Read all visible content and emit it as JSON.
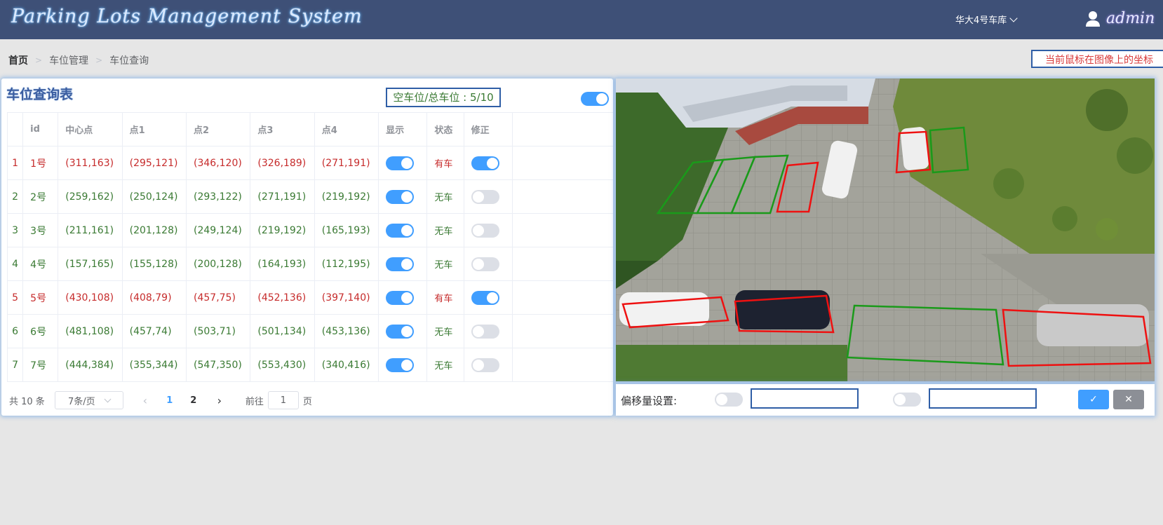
{
  "header": {
    "app_title": "Parking Lots Management System",
    "garage_label": "华大4号车库",
    "user_name": "admin"
  },
  "breadcrumb": [
    "首页",
    "车位管理",
    "车位查询"
  ],
  "coord_hint": "当前鼠标在图像上的坐标",
  "panel": {
    "title": "车位查询表",
    "space_count": "空车位/总车位 : 5/10",
    "master_toggle_on": true
  },
  "table": {
    "columns": [
      "",
      "id",
      "中心点",
      "点1",
      "点2",
      "点3",
      "点4",
      "显示",
      "状态",
      "修正"
    ],
    "rows": [
      {
        "idx": "1",
        "id": "1号",
        "center": "(311,163)",
        "p1": "(295,121)",
        "p2": "(346,120)",
        "p3": "(326,189)",
        "p4": "(271,191)",
        "show": true,
        "state": "有车",
        "fix": true,
        "occupied": true
      },
      {
        "idx": "2",
        "id": "2号",
        "center": "(259,162)",
        "p1": "(250,124)",
        "p2": "(293,122)",
        "p3": "(271,191)",
        "p4": "(219,192)",
        "show": true,
        "state": "无车",
        "fix": false,
        "occupied": false
      },
      {
        "idx": "3",
        "id": "3号",
        "center": "(211,161)",
        "p1": "(201,128)",
        "p2": "(249,124)",
        "p3": "(219,192)",
        "p4": "(165,193)",
        "show": true,
        "state": "无车",
        "fix": false,
        "occupied": false
      },
      {
        "idx": "4",
        "id": "4号",
        "center": "(157,165)",
        "p1": "(155,128)",
        "p2": "(200,128)",
        "p3": "(164,193)",
        "p4": "(112,195)",
        "show": true,
        "state": "无车",
        "fix": false,
        "occupied": false
      },
      {
        "idx": "5",
        "id": "5号",
        "center": "(430,108)",
        "p1": "(408,79)",
        "p2": "(457,75)",
        "p3": "(452,136)",
        "p4": "(397,140)",
        "show": true,
        "state": "有车",
        "fix": true,
        "occupied": true
      },
      {
        "idx": "6",
        "id": "6号",
        "center": "(481,108)",
        "p1": "(457,74)",
        "p2": "(503,71)",
        "p3": "(501,134)",
        "p4": "(453,136)",
        "show": true,
        "state": "无车",
        "fix": false,
        "occupied": false
      },
      {
        "idx": "7",
        "id": "7号",
        "center": "(444,384)",
        "p1": "(355,344)",
        "p2": "(547,350)",
        "p3": "(553,430)",
        "p4": "(340,416)",
        "show": true,
        "state": "无车",
        "fix": false,
        "occupied": false
      }
    ]
  },
  "pager": {
    "total": "共 10 条",
    "page_size": "7条/页",
    "pages": [
      "1",
      "2"
    ],
    "current_page": "1",
    "goto_prefix": "前往",
    "goto_value": "1",
    "goto_suffix": "页"
  },
  "offset": {
    "label": "偏移量设置:",
    "toggle1_on": false,
    "toggle2_on": false,
    "ok_icon": "✓",
    "cancel_icon": "✕"
  },
  "colors": {
    "header_bg": "#3e5077",
    "accent": "#409eff",
    "occupied": "#c62b2b",
    "free": "#3a7a33",
    "box_border": "#2f5ea6"
  }
}
